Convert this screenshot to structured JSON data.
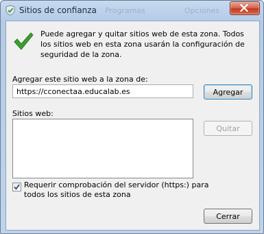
{
  "window": {
    "title": "Sitios de confianza",
    "background_tabs": [
      "Programas",
      "Opciones"
    ]
  },
  "info": {
    "text": "Puede agregar y quitar sitios web de esta zona. Todos los sitios web en esta zona usarán la configuración de seguridad de la zona."
  },
  "add_site": {
    "label": "Agregar este sitio web a la zona de:",
    "value": "https://cconectaa.educalab.es",
    "add_button": "Agregar"
  },
  "sites": {
    "label": "Sitios web:",
    "items": [],
    "remove_button": "Quitar"
  },
  "https_requirement": {
    "checked": true,
    "label": "Requerir comprobación del servidor (https:) para todos los sitios de esta zona"
  },
  "footer": {
    "close_button": "Cerrar"
  },
  "colors": {
    "check_green": "#3aa12e",
    "close_red": "#c4391f",
    "client_bg": "#f0f0f0",
    "frame_blue": "#b4cbe6"
  },
  "icons": {
    "title": "shield-checkmark-icon",
    "info": "green-checkmark-icon",
    "close": "close-x-icon"
  }
}
